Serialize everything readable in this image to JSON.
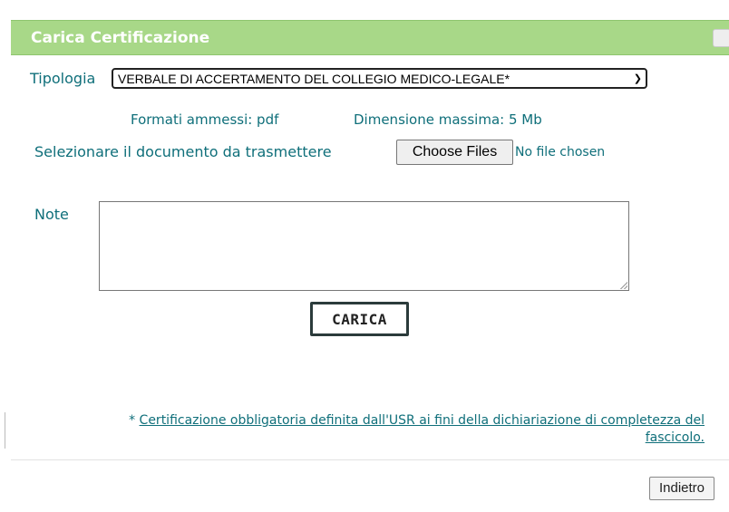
{
  "dialog": {
    "title": "Carica Certificazione"
  },
  "form": {
    "tipologia_label": "Tipologia",
    "tipologia_selected": "VERBALE DI ACCERTAMENTO DEL COLLEGIO MEDICO-LEGALE*",
    "formats_text": "Formati ammessi: pdf",
    "maxsize_text": "Dimensione massima: 5 Mb",
    "select_doc_label": "Selezionare il documento da trasmettere",
    "choose_files_label": "Choose Files",
    "no_file_text": "No file chosen",
    "note_label": "Note",
    "note_value": "",
    "upload_button_label": "CARICA"
  },
  "footnote": {
    "asterisk": "* ",
    "text": "Certificazione obbligatoria definita dall'USR ai fini della dichiariazione di completezza del fascicolo."
  },
  "footer": {
    "back_button_label": "Indietro"
  },
  "colors": {
    "header_bg": "#a8d888",
    "accent_text": "#0f6f7a"
  }
}
